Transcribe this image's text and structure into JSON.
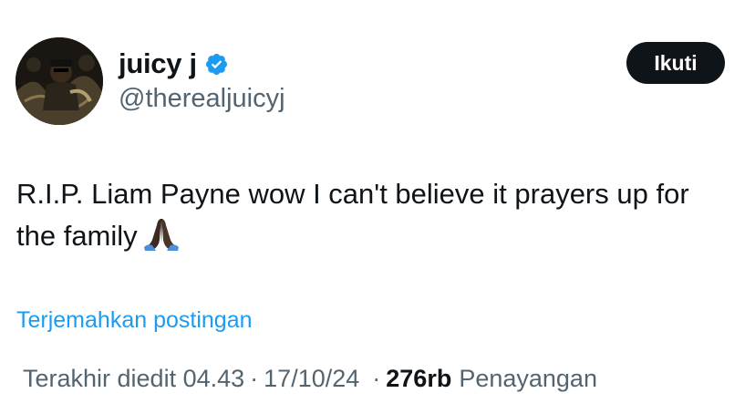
{
  "author": {
    "display_name": "juicy j",
    "handle": "@therealjuicyj",
    "verified": true,
    "verified_color": "#1d9bf0"
  },
  "follow_button": {
    "label": "Ikuti"
  },
  "tweet": {
    "text": "R.I.P. Liam Payne wow I can't believe it  prayers up for the family",
    "emoji": "folded-hands"
  },
  "translate_link": {
    "label": "Terjemahkan postingan"
  },
  "meta": {
    "edited_label": "Terakhir diedit 04.43",
    "date": "17/10/24",
    "separator": "·",
    "views_count": "276rb",
    "views_label": "Penayangan"
  },
  "colors": {
    "text": "#0f1419",
    "secondary": "#536471",
    "link": "#1d9bf0",
    "button_bg": "#0f1419"
  }
}
